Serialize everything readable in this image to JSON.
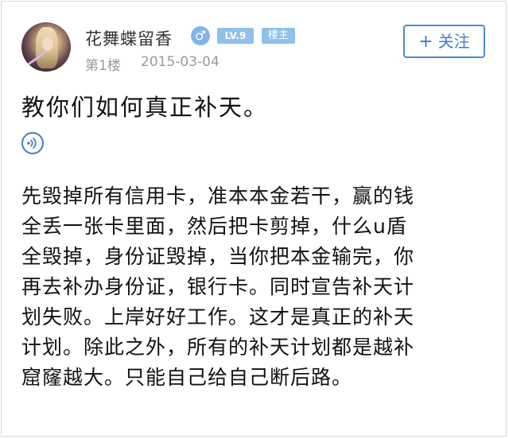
{
  "post": {
    "user": {
      "name": "花舞蝶留香",
      "gender_symbol": "♂",
      "level": "LV.9",
      "owner_badge": "楼主"
    },
    "floor": "第1楼",
    "date": "2015-03-04",
    "follow_label": "关注",
    "follow_plus": "+",
    "title": "教你们如何真正补天。",
    "body_lines": [
      "先毁掉所有信用卡，准本本金若干，赢的钱",
      "全丢一张卡里面，然后把卡剪掉，什么u盾",
      "全毁掉，身份证毁掉，当你把本金输完，你",
      "再去补办身份证，银行卡。同时宣告补天计",
      "划失败。上岸好好工作。这才是真正的补天",
      "计划。除此之外，所有的补天计划都是越补",
      "窟窿越大。只能自己给自己断后路。"
    ]
  },
  "colors": {
    "accent": "#3d7fcf",
    "badge": "#8fc1ea",
    "meta_text": "#9a9a9a"
  },
  "icons": {
    "gender": "male-icon",
    "voice": "voice-icon",
    "avatar": "user-avatar"
  }
}
